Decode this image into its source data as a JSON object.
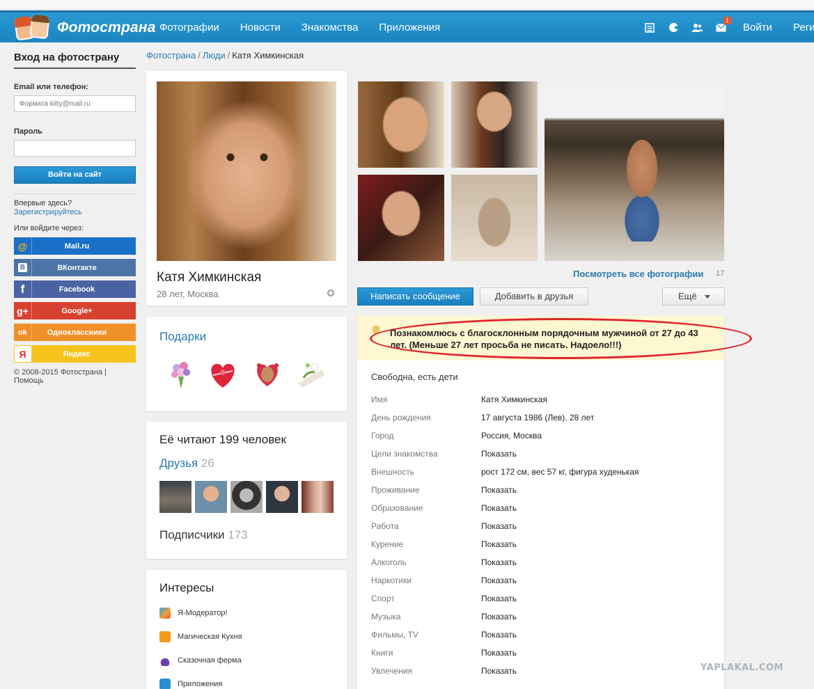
{
  "header": {
    "logo_text": "Фотострана",
    "nav": [
      "Фотографии",
      "Новости",
      "Знакомства",
      "Приложения"
    ],
    "mail_badge": "1",
    "login": "Войти",
    "register": "Регистрация"
  },
  "sidebar": {
    "title": "Вход на фотострану",
    "email_label": "Email или телефон:",
    "email_placeholder": "Формата kitty@mail.ru",
    "password_label": "Пароль",
    "login_button": "Войти на сайт",
    "first_time": "Впервые здесь?",
    "register_link": "Зарегистрируйтесь",
    "or_login_via": "Или войдите через:",
    "social": [
      {
        "icon": "@",
        "label": "Mail.ru",
        "color": "#1a6fc9"
      },
      {
        "icon": "B",
        "label": "ВКонтакте",
        "color": "#4d74a6"
      },
      {
        "icon": "f",
        "label": "Facebook",
        "color": "#4a63a3"
      },
      {
        "icon": "g+",
        "label": "Google+",
        "color": "#d8412f"
      },
      {
        "icon": "ok",
        "label": "Одноклассники",
        "color": "#f0902a"
      },
      {
        "icon": "Я",
        "label": "Яндекс",
        "color": "#f6c31c"
      }
    ],
    "footer_copyright": "© 2008-2015 Фотострана",
    "footer_help": "Помощь"
  },
  "breadcrumb": {
    "home": "Фотострана",
    "people": "Люди",
    "current": "Катя Химкинская"
  },
  "profile": {
    "name": "Катя Химкинская",
    "meta": "28 лет, Москва"
  },
  "gifts": {
    "title": "Подарки"
  },
  "readers": {
    "title": "Её читают 199 человек",
    "friends_label": "Друзья",
    "friends_count": "26",
    "subscribers_label": "Подписчики",
    "subscribers_count": "173"
  },
  "interests": {
    "title": "Интересы",
    "items": [
      "Я-Модератор!",
      "Магическая Кухня",
      "Сказочная ферма",
      "Приложения"
    ]
  },
  "photos": {
    "see_all": "Посмотреть все фотографии",
    "count": "17"
  },
  "actions": {
    "message": "Написать сообщение",
    "add_friend": "Добавить в друзья",
    "more": "Ещё"
  },
  "info": {
    "status": "Познакомлюсь с благосклонным порядочным мужчиной от 27 до 43 лет. (Меньше 27 лет просьба не писать. Надоело!!!)",
    "family": "Свободна, есть дети",
    "rows": [
      {
        "key": "Имя",
        "value": "Катя Химкинская"
      },
      {
        "key": "День рождения",
        "value": "17 августа 1986 (Лев), 28 лет"
      },
      {
        "key": "Город",
        "value": "Россия, Москва"
      },
      {
        "key": "Цели знакомства",
        "value": "Показать"
      },
      {
        "key": "Внешность",
        "value": "рост 172 см, вес 57 кг, фигура худенькая"
      },
      {
        "key": "Проживание",
        "value": "Показать"
      },
      {
        "key": "Образование",
        "value": "Показать"
      },
      {
        "key": "Работа",
        "value": "Показать"
      },
      {
        "key": "Курение",
        "value": "Показать"
      },
      {
        "key": "Алкоголь",
        "value": "Показать"
      },
      {
        "key": "Наркотики",
        "value": "Показать"
      },
      {
        "key": "Спорт",
        "value": "Показать"
      },
      {
        "key": "Музыка",
        "value": "Показать"
      },
      {
        "key": "Фильмы, TV",
        "value": "Показать"
      },
      {
        "key": "Книги",
        "value": "Показать"
      },
      {
        "key": "Увлечения",
        "value": "Показать"
      }
    ]
  },
  "watermark": "YAPLAKAL.COM",
  "colors": {
    "brand": "#1f8fcb",
    "link": "#2a7ab0",
    "status_bg": "#fdf7d2",
    "highlight": "#e0232a"
  }
}
